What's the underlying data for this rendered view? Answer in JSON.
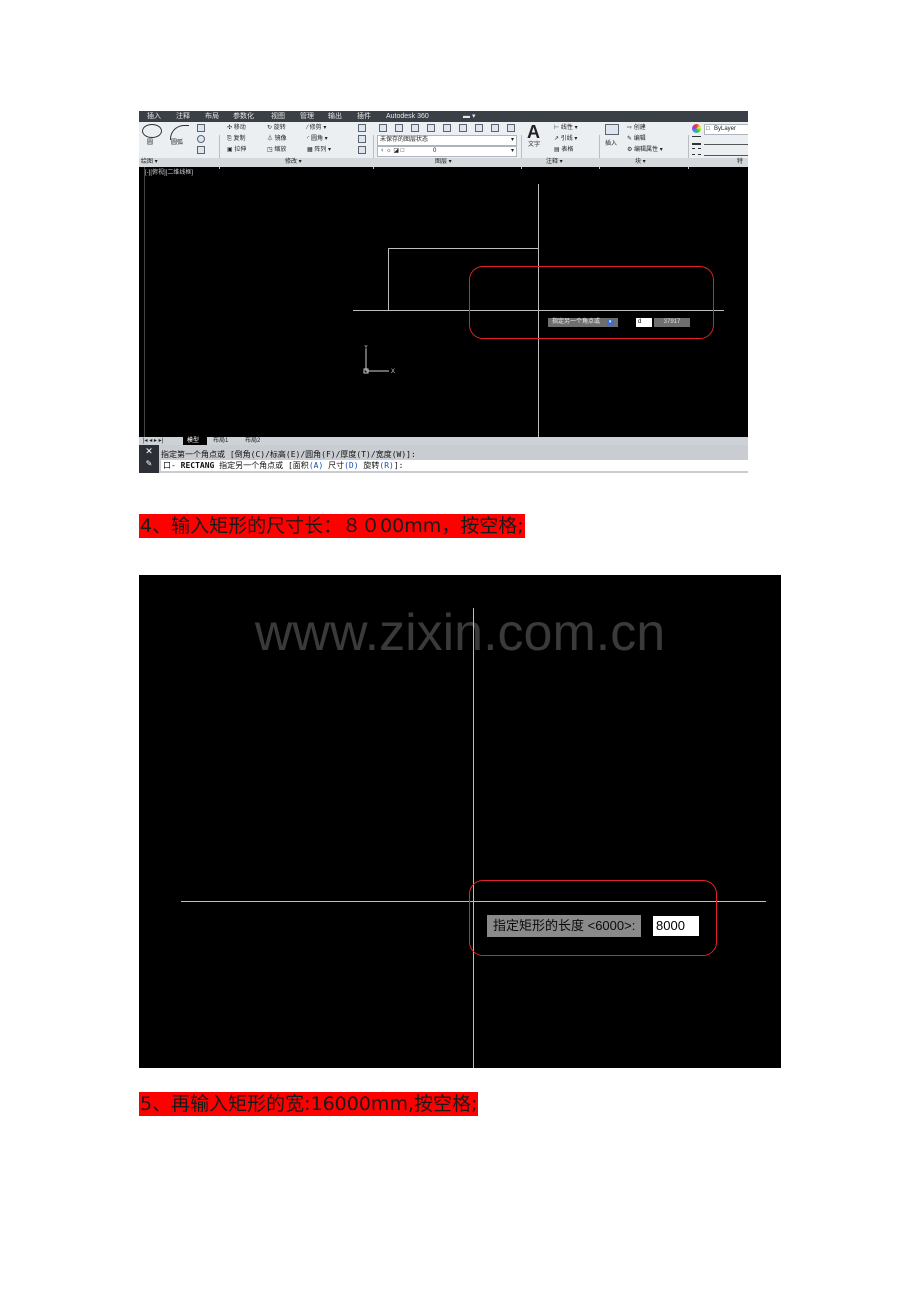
{
  "ribbon": {
    "tabs": [
      "插入",
      "注释",
      "布局",
      "参数化",
      "视图",
      "管理",
      "输出",
      "插件",
      "Autodesk 360"
    ],
    "tools": {
      "circle": "圆",
      "arc": "圆弧",
      "move": "移动",
      "rotate": "旋转",
      "trim": "修剪",
      "copy": "复制",
      "mirror": "镜像",
      "fillet": "圆角",
      "stretch": "拉伸",
      "scale": "缩放",
      "array": "阵列",
      "layer_state": "未保存的图层状态",
      "layer_name": "0",
      "text": "文字",
      "linear_dim": "线性",
      "leader": "引线",
      "table": "表格",
      "insert": "插入",
      "create": "创建",
      "edit": "编辑",
      "edit_attr": "编辑属性",
      "bylayer": "ByLayer"
    },
    "panels": [
      "绘图 ▾",
      "修改 ▾",
      "图层 ▾",
      "注释 ▾",
      "块 ▾",
      "特"
    ]
  },
  "viewport": {
    "label": "[-][俯视][二维线框]",
    "corner_prompt": "指定另一个角点或",
    "corner_input": "d",
    "corner_value": "37917",
    "ucs_x": "X",
    "ucs_y": "Y"
  },
  "layout_tabs": [
    "模型",
    "布局1",
    "布局2"
  ],
  "command": {
    "history": "指定第一个角点或 [倒角(C)/标高(E)/圆角(F)/厚度(T)/宽度(W)]:",
    "current_prefix": "口- ",
    "current_cmd": "RECTANG",
    "current_text": " 指定另一个角点或 [面积",
    "opt_area": "(A)",
    "dim_text": " 尺寸",
    "opt_dim": "(D)",
    "rot_text": " 旋转",
    "opt_rot": "(R)",
    "end": "]:"
  },
  "caption1": "4、输入矩形的尺寸长：８０00mm，按空格;",
  "screenshot2": {
    "watermark": "www.zixin.com.cn",
    "length_prompt": "指定矩形的长度 <6000>:",
    "length_input": "8000"
  },
  "caption2": "5、再输入矩形的宽:16000mm,按空格;",
  "colors": {
    "highlight_red": "#ff0000",
    "callout_red": "#e0202a",
    "canvas": "#000000"
  }
}
